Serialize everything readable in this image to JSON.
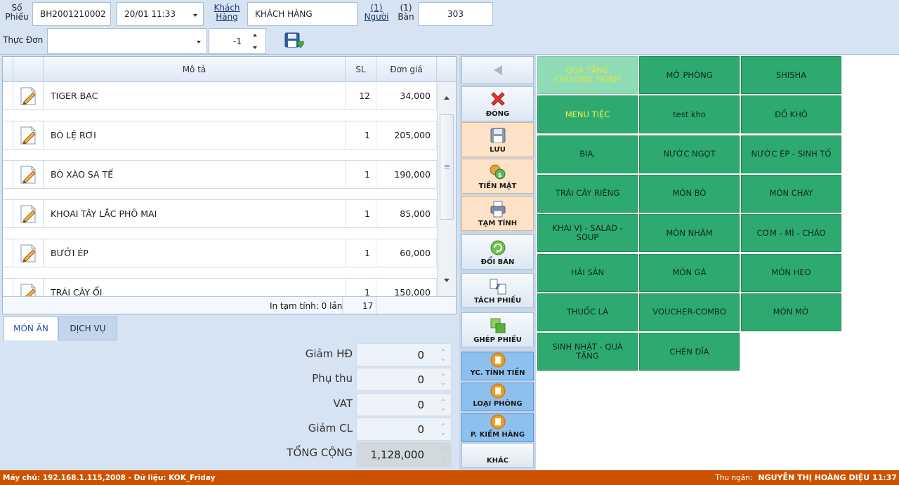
{
  "header": {
    "so_phieu_label": "Số Phiếu",
    "so_phieu_value": "BH2001210002",
    "datetime_value": "20/01 11:33",
    "khach_hang_label": "Khách Hàng",
    "khach_hang_value": "KHÁCH HÀNG",
    "guest_count_link": "(1)",
    "guest_label": "Người",
    "table_count_link": "(1)",
    "table_label": "Bàn",
    "table_value": "303",
    "thuc_don_label": "Thực Đơn",
    "thuc_don_value": "",
    "qty_value": "-1"
  },
  "grid": {
    "columns": {
      "desc": "Mô tả",
      "qty": "SL",
      "price": "Đơn giá"
    },
    "rows": [
      {
        "name": "TIGER BẠC",
        "qty": "12",
        "price": "34,000"
      },
      {
        "name": "BÒ LỆ RƠI",
        "qty": "1",
        "price": "205,000"
      },
      {
        "name": "BÒ XÀO SA TẾ",
        "qty": "1",
        "price": "190,000"
      },
      {
        "name": "KHOAI TÂY LẮC  PHÔ MAI",
        "qty": "1",
        "price": "85,000"
      },
      {
        "name": "BƯỞI ÉP",
        "qty": "1",
        "price": "60,000"
      },
      {
        "name": "TRÁI CÂY ỔI",
        "qty": "1",
        "price": "150,000"
      }
    ],
    "footer_label": "In tạm tính: 0 lần",
    "footer_qty": "17"
  },
  "tabs": {
    "food": "MÓN ĂN",
    "service": "DỊCH VỤ"
  },
  "totals": [
    {
      "label": "Giảm HĐ",
      "value": "0"
    },
    {
      "label": "Phụ thu",
      "value": "0"
    },
    {
      "label": "VAT",
      "value": "0"
    },
    {
      "label": "Giảm CL",
      "value": "0"
    },
    {
      "label": "TỔNG CỘNG",
      "value": "1,128,000"
    }
  ],
  "actions": {
    "close": "ĐÓNG",
    "save": "LƯU",
    "cash": "TIỀN MẶT",
    "temp_bill": "TẠM TÍNH",
    "change_table": "ĐỔI BÀN",
    "split_bill": "TÁCH PHIẾU",
    "merge_bill": "GHÉP PHIẾU",
    "request_bill": "YC. TÍNH TIỀN",
    "room_type": "LOẠI PHÒNG",
    "check_goods": "P. KIỂM HÀNG",
    "other": "KHÁC"
  },
  "categories": [
    "QUÀ TẶNG CHƯƠNG TRÌNH",
    "MỞ PHÒNG",
    "SHISHA",
    "MENU TIỆC",
    "test kho",
    "ĐỒ KHÔ",
    "BIA.",
    "NƯỚC NGỌT",
    "NƯỚC ÉP - SINH TỐ",
    "TRÁI CÂY RIÊNG",
    "MÓN BÒ",
    "MÓN CHAY",
    "KHAI VỊ - SALAD - SOUP",
    "MÓN NHÃM",
    "CƠM - MÌ - CHÁO",
    "HẢI SẢN",
    "MÓN GÀ",
    "MÓN HEO",
    "THUỐC LÁ",
    "VOUCHER-COMBO",
    "MÓN MỞ",
    "SINH NHẬT - QUÀ TẶNG",
    "CHÉN DĨA"
  ],
  "status": {
    "left": "Máy chủ: 192.168.1.115,2008 - Dữ liệu: KOK_Friday",
    "cashier_label": "Thu ngân:",
    "cashier_value": "NGUYỄN THỊ HOÀNG DIỆU 11:37"
  },
  "colors": {
    "tile_green": "#2eaa70",
    "tile_light": "#8fdcb4",
    "status_bar": "#cc5200",
    "peach_button": "#fde2c8",
    "blue_button": "#8ec0ee"
  }
}
